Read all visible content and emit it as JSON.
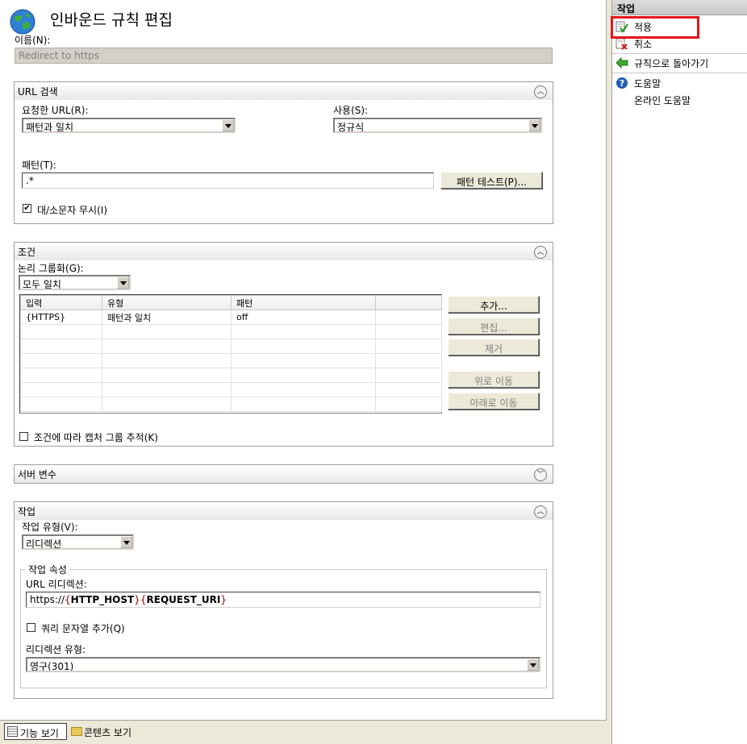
{
  "page": {
    "title": "인바운드 규칙 편집",
    "name_label": "이름(N):",
    "name_value": "Redirect to https"
  },
  "match_url": {
    "section_title": "URL 검색",
    "requested_url_label": "요청한 URL(R):",
    "requested_url_value": "패턴과 일치",
    "using_label": "사용(S):",
    "using_value": "정규식",
    "pattern_label": "패턴(T):",
    "pattern_value": ".*",
    "test_pattern_button": "패턴 테스트(P)...",
    "ignore_case_label": "대/소문자 무시(I)",
    "ignore_case_checked": true
  },
  "conditions": {
    "section_title": "조건",
    "logical_grouping_label": "논리 그룹화(G):",
    "logical_grouping_value": "모두 일치",
    "columns": [
      "입력",
      "유형",
      "패턴",
      ""
    ],
    "rows": [
      [
        "{HTTPS}",
        "패턴과 일치",
        "off",
        ""
      ]
    ],
    "empty_rows": 6,
    "buttons": {
      "add": "추가...",
      "edit": "편집...",
      "remove": "제거",
      "move_up": "위로 이동",
      "move_down": "아래로 이동"
    },
    "track_capture_label": "조건에 따라 캡처 그룹 추적(K)",
    "track_capture_checked": false
  },
  "server_variables": {
    "section_title": "서버 변수"
  },
  "action": {
    "section_title": "작업",
    "action_type_label": "작업 유형(V):",
    "action_type_value": "리디렉션",
    "properties_legend": "작업 속성",
    "redirect_url_label": "URL 리디렉션:",
    "redirect_url_prefix": "https://",
    "redirect_url_var1": "{HTTP_HOST}",
    "redirect_url_var2": "{REQUEST_URI}",
    "append_query_label": "쿼리 문자열 추가(Q)",
    "append_query_checked": false,
    "redirect_type_label": "리디렉션 유형:",
    "redirect_type_value": "영구(301)"
  },
  "actions_pane": {
    "title": "작업",
    "items": [
      {
        "label": "적용",
        "icon": "apply-icon"
      },
      {
        "label": "취소",
        "icon": "cancel-icon"
      },
      {
        "label": "규칙으로 돌아가기",
        "icon": "back-arrow-icon"
      },
      {
        "label": "도움말",
        "icon": "help-icon"
      },
      {
        "label": "온라인 도움말",
        "icon": ""
      }
    ],
    "colors": {
      "highlight": "#e8151b",
      "link": "#000000"
    }
  },
  "bottom_bar": {
    "features_view": "기능 보기",
    "content_view": "콘텐츠 보기"
  }
}
